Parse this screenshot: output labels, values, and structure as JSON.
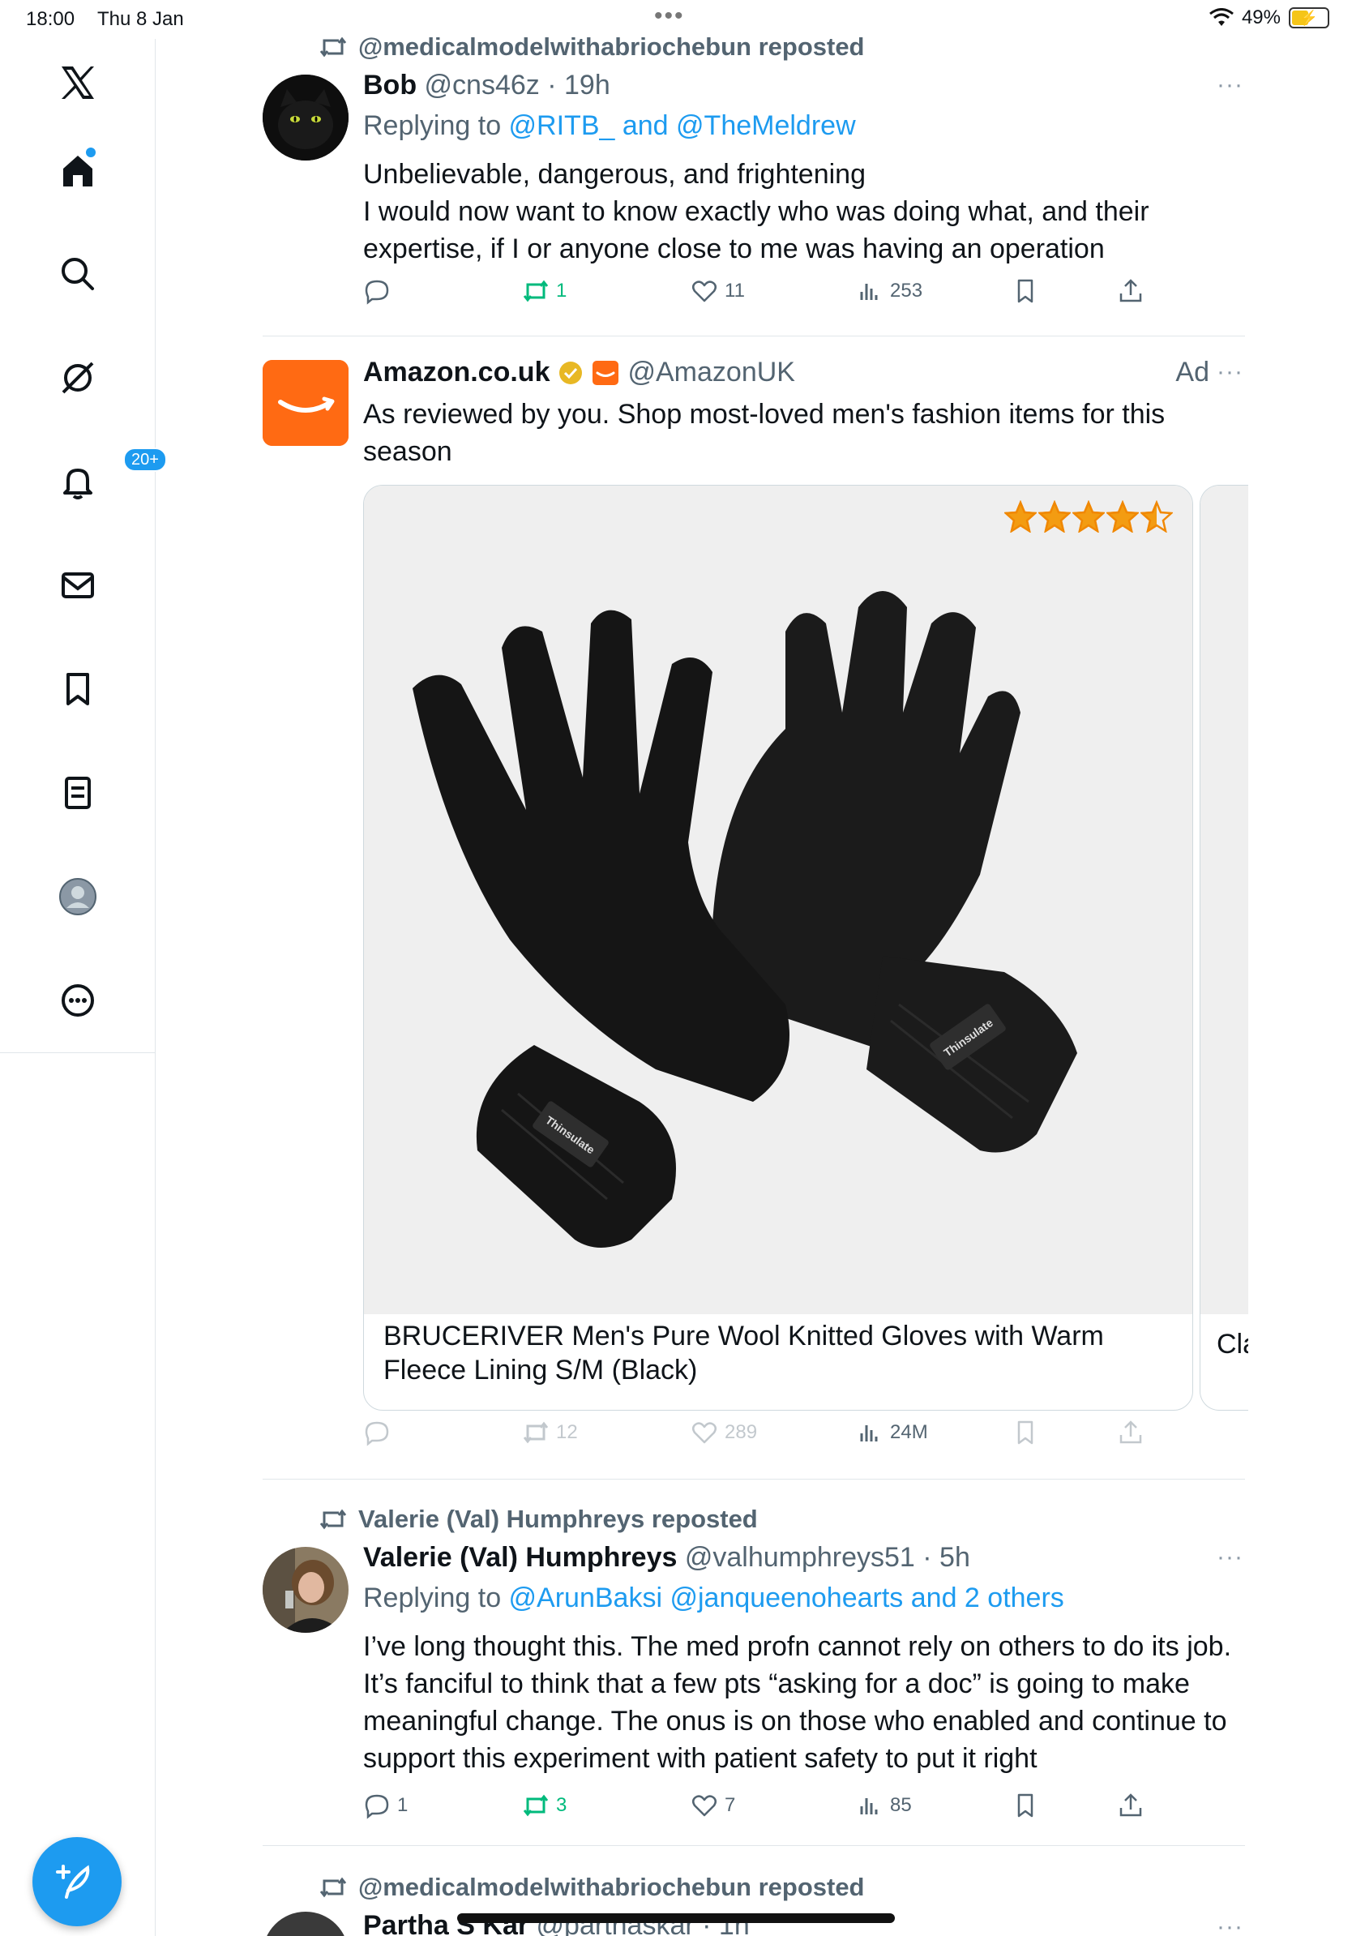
{
  "status_bar": {
    "time": "18:00",
    "date": "Thu 8 Jan",
    "battery": "49%",
    "icons": [
      "wifi-icon",
      "battery-charging-icon"
    ]
  },
  "sidebar": {
    "items": [
      {
        "name": "x-logo",
        "icon": "x-logo-icon"
      },
      {
        "name": "home",
        "icon": "home-icon"
      },
      {
        "name": "search",
        "icon": "search-icon"
      },
      {
        "name": "grok",
        "icon": "grok-icon"
      },
      {
        "name": "notifications",
        "icon": "bell-icon",
        "badge": "20+"
      },
      {
        "name": "messages",
        "icon": "envelope-icon"
      },
      {
        "name": "bookmarks",
        "icon": "bookmark-icon"
      },
      {
        "name": "lists",
        "icon": "list-icon"
      },
      {
        "name": "profile",
        "icon": "avatar-icon"
      },
      {
        "name": "more",
        "icon": "more-circle-icon"
      }
    ],
    "compose_icon": "compose-icon"
  },
  "colors": {
    "accent": "#1d9bf0",
    "repost_green": "#00ba7c",
    "muted": "#536471",
    "amazon_orange": "#ff6a13"
  },
  "posts": [
    {
      "reposted_by": "@medicalmodelwithabriochebun reposted",
      "name": "Bob",
      "handle_time": "@cns46z · 19h",
      "replying_prefix": "Replying to ",
      "replying_to": "@RITB_ and @TheMeldrew",
      "text": "Unbelievable, dangerous, and frightening\nI would now want to know exactly who was doing what, and their expertise, if I or anyone close to me was having an operation",
      "more": "···",
      "actions": {
        "replies": "",
        "reposts": "1",
        "likes": "11",
        "views": "253"
      }
    },
    {
      "name": "Amazon.co.uk",
      "handle": "@AmazonUK",
      "ad_label": "Ad",
      "more": "···",
      "text": "As reviewed by you. Shop most-loved men's fashion items for this season",
      "rating_stars": 4.5,
      "card_title": "BRUCERIVER Men's Pure Wool Knitted Gloves with Warm Fleece Lining S/M (Black)",
      "next_card_title": "Cla",
      "label_text": "Thinsulate",
      "actions": {
        "replies": "",
        "reposts": "12",
        "likes": "289",
        "views": "24M"
      }
    },
    {
      "reposted_by": "Valerie (Val) Humphreys reposted",
      "name": "Valerie (Val) Humphreys",
      "handle_time": "@valhumphreys51 · 5h",
      "replying_prefix": "Replying to ",
      "replying_to": "@ArunBaksi @janqueenohearts and 2 others",
      "text": "I’ve long thought this. The med profn cannot rely on others to do its job. It’s fanciful to think that a few pts “asking for a doc” is going to make meaningful change. The onus is on those who enabled and continue to support this experiment with patient safety to put it right",
      "more": "···",
      "actions": {
        "replies": "1",
        "reposts": "3",
        "likes": "7",
        "views": "85"
      }
    },
    {
      "reposted_by": "@medicalmodelwithabriochebun reposted",
      "name": "Partha S Kar",
      "handle_time": "@parthaskar · 1h",
      "more": "···"
    }
  ]
}
